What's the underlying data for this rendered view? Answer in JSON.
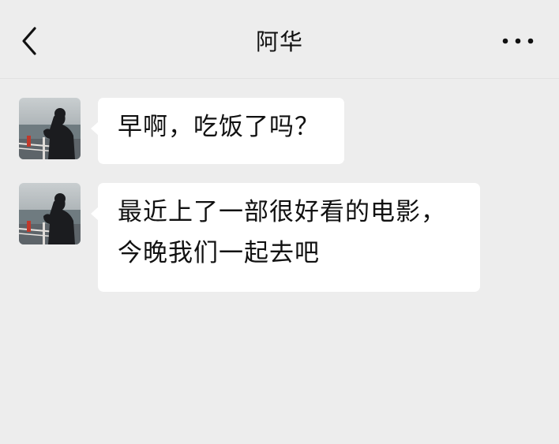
{
  "header": {
    "title": "阿华",
    "back_icon": "chevron-left-icon",
    "more_icon": "more-dots-icon"
  },
  "messages": [
    {
      "sender": "阿华",
      "avatar": "avatar-icon",
      "text": "早啊，吃饭了吗？"
    },
    {
      "sender": "阿华",
      "avatar": "avatar-icon",
      "lines": [
        "最近上了一部很好看的电影，",
        "今晚我们一起去吧"
      ]
    }
  ],
  "colors": {
    "background": "#ededed",
    "bubble": "#ffffff",
    "text": "#111111"
  }
}
